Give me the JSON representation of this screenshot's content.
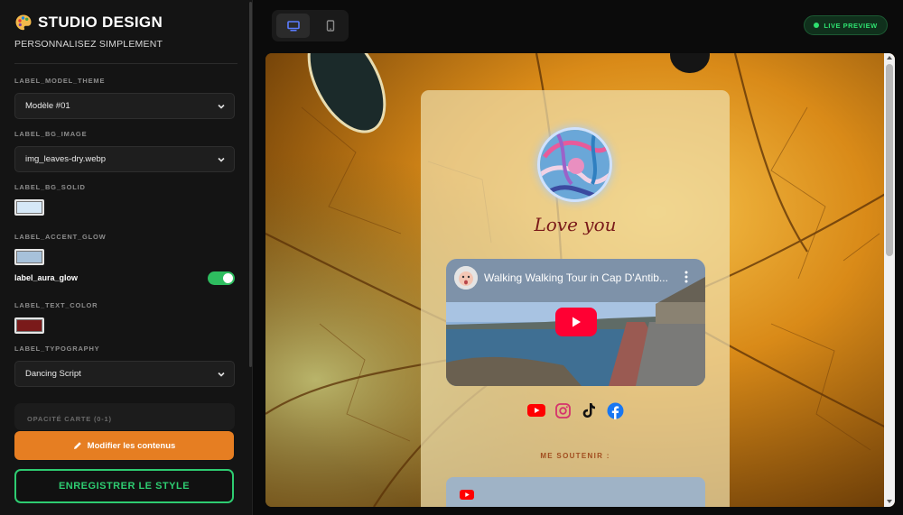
{
  "sidebar": {
    "brand_title": "STUDIO DESIGN",
    "brand_subtitle": "PERSONNALISEZ SIMPLEMENT",
    "brand_icon": "palette-icon",
    "fields": {
      "model_theme_label": "LABEL_MODEL_THEME",
      "model_theme_value": "Modèle #01",
      "bg_image_label": "LABEL_BG_IMAGE",
      "bg_image_value": "img_leaves-dry.webp",
      "bg_solid_label": "LABEL_BG_SOLID",
      "bg_solid_color": "#d6e8f7",
      "accent_glow_label": "LABEL_ACCENT_GLOW",
      "accent_glow_color": "#a7c1da",
      "aura_glow_label": "label_aura_glow",
      "aura_glow_enabled": true,
      "text_color_label": "LABEL_TEXT_COLOR",
      "text_color": "#7a1a1a",
      "typography_label": "LABEL_TYPOGRAPHY",
      "typography_value": "Dancing Script",
      "collapsed_panel_label": "OPACITÉ CARTE (0-1)"
    },
    "edit_button": "Modifier les contenus",
    "save_button": "ENREGISTRER LE STYLE"
  },
  "topbar": {
    "devices": [
      "desktop-icon",
      "mobile-icon"
    ],
    "active_device": "desktop",
    "live_badge": "LIVE PREVIEW"
  },
  "preview": {
    "headline": "Love you",
    "video": {
      "title": "Walking Walking Tour in Cap D'Antib...",
      "play_icon": "play-icon"
    },
    "socials": [
      "youtube-icon",
      "instagram-icon",
      "tiktok-icon",
      "facebook-icon"
    ],
    "support_label": "ME SOUTENIR :"
  },
  "colors": {
    "accent_orange": "#e67e22",
    "accent_green": "#2ecc71",
    "text_red": "#7a1a1a"
  }
}
